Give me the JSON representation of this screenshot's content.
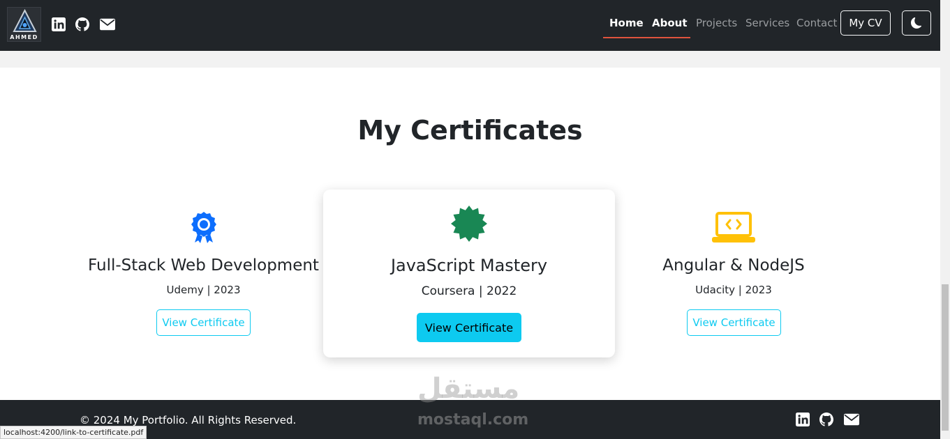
{
  "brand": {
    "logo_text": "AHMED"
  },
  "nav": {
    "links": [
      "Home",
      "About",
      "Projects",
      "Services",
      "Contact"
    ],
    "cv_label": "My CV"
  },
  "section": {
    "title": "My Certificates"
  },
  "certificates": [
    {
      "title": "Full-Stack Web Development",
      "issuer": "Udemy | 2023",
      "button": "View Certificate",
      "icon": "award-icon",
      "color": "#0d6efd"
    },
    {
      "title": "JavaScript Mastery",
      "issuer": "Coursera | 2022",
      "button": "View Certificate",
      "icon": "patch-icon",
      "color": "#198754"
    },
    {
      "title": "Angular & NodeJS",
      "issuer": "Udacity | 2023",
      "button": "View Certificate",
      "icon": "laptop-code-icon",
      "color": "#ffc107"
    }
  ],
  "footer": {
    "copyright": "© 2024 My Portfolio. All Rights Reserved."
  },
  "watermark": {
    "arabic": "مستقل",
    "latin": "mostaql.com"
  },
  "status_bar": {
    "url": "localhost:4200/link-to-certificate.pdf"
  },
  "colors": {
    "accent": "#0dcaf0",
    "nav_bg": "#212529",
    "underline": "#e0533d"
  }
}
